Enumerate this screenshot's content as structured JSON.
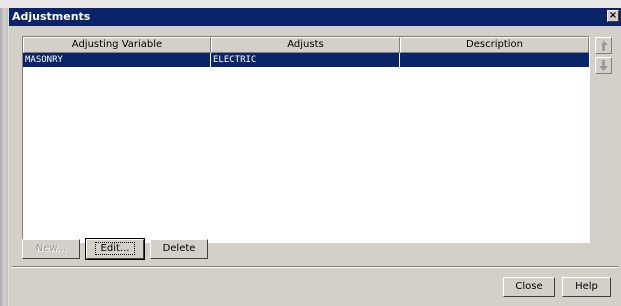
{
  "dialog": {
    "title": "Adjustments",
    "close_glyph": "×"
  },
  "table": {
    "columns": [
      "Adjusting Variable",
      "Adjusts",
      "Description"
    ],
    "rows": [
      {
        "adjusting_variable": "MASONRY",
        "adjusts": "ELECTRIC",
        "description": "",
        "selected": true
      }
    ]
  },
  "side_buttons": {
    "move_up_icon": "arrow-up-icon",
    "move_down_icon": "arrow-down-icon",
    "enabled": false
  },
  "buttons": {
    "new_label": "New...",
    "new_enabled": false,
    "edit_label": "Edit...",
    "delete_label": "Delete",
    "close_label": "Close",
    "help_label": "Help"
  },
  "colors": {
    "title_bar": "#0a246a",
    "selection": "#0a246a",
    "face": "#d4d0c8"
  }
}
